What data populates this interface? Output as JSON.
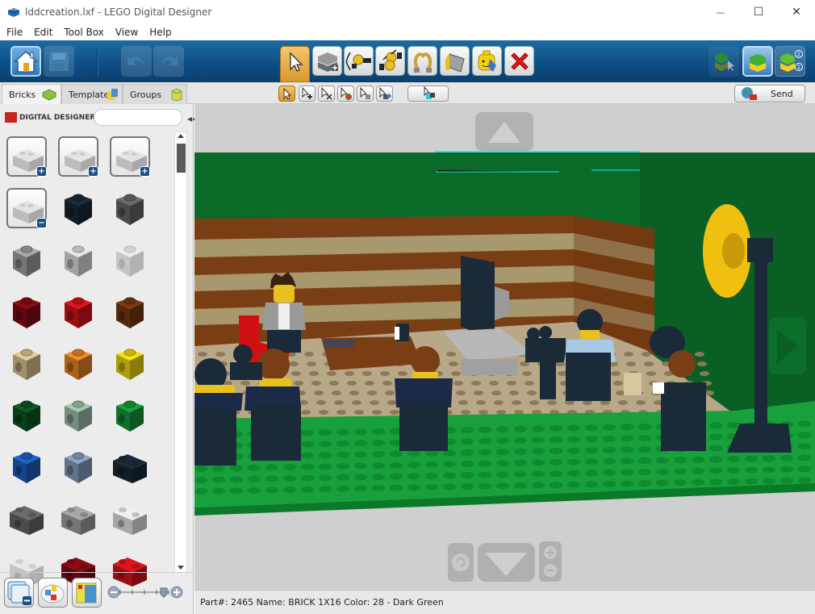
{
  "window": {
    "title": "lddcreation.lxf - LEGO Digital Designer",
    "controls": {
      "minimize": "—",
      "maximize": "☐",
      "close": "✕"
    }
  },
  "menu": {
    "items": [
      {
        "label": "File"
      },
      {
        "label": "Edit"
      },
      {
        "label": "Tool Box"
      },
      {
        "label": "View"
      },
      {
        "label": "Help"
      }
    ]
  },
  "toolbar": {
    "left": [
      {
        "name": "home",
        "icon": "home-icon",
        "enabled": true
      },
      {
        "name": "save",
        "icon": "save-icon",
        "enabled": false
      },
      {
        "name": "undo",
        "icon": "undo-icon",
        "enabled": false
      },
      {
        "name": "redo",
        "icon": "redo-icon",
        "enabled": false
      }
    ],
    "tools": [
      {
        "name": "select",
        "icon": "cursor-icon",
        "active": true
      },
      {
        "name": "clone",
        "icon": "clone-brick-icon"
      },
      {
        "name": "hinge",
        "icon": "hinge-icon"
      },
      {
        "name": "hinge-align",
        "icon": "hinge-align-icon"
      },
      {
        "name": "flex",
        "icon": "flex-icon"
      },
      {
        "name": "paint",
        "icon": "paint-bucket-icon"
      },
      {
        "name": "decorate",
        "icon": "minifig-decorate-icon"
      },
      {
        "name": "delete",
        "icon": "delete-x-icon"
      }
    ],
    "modes": [
      {
        "name": "build-mode",
        "icon": "build-mode-icon"
      },
      {
        "name": "view-mode",
        "icon": "view-mode-icon"
      },
      {
        "name": "building-guide-mode",
        "icon": "building-guide-icon"
      }
    ]
  },
  "palette_tabs": [
    {
      "label": "Bricks",
      "active": true
    },
    {
      "label": "Templates",
      "active": false
    },
    {
      "label": "Groups",
      "active": false
    }
  ],
  "select_subtools": [
    {
      "name": "single-select",
      "active": true
    },
    {
      "name": "add-to-selection"
    },
    {
      "name": "remove-from-selection"
    },
    {
      "name": "select-same-color"
    },
    {
      "name": "select-same-shape"
    },
    {
      "name": "select-same-color-shape"
    }
  ],
  "wide_subtool": {
    "name": "select-connected"
  },
  "send": {
    "label": "Send"
  },
  "sidebar": {
    "brand": "DIGITAL DESIGNER",
    "search_placeholder": "",
    "bricks": [
      {
        "kind": "brick-2x4-group",
        "color": "#d6d6d6",
        "badge": "+"
      },
      {
        "kind": "round-brick-group",
        "color": "#d6d6d6",
        "badge": "+"
      },
      {
        "kind": "technic-brick-group",
        "color": "#d6d6d6",
        "badge": "+"
      },
      {
        "kind": "technic-beam-group",
        "color": "#d6d6d6",
        "badge": "−"
      },
      {
        "kind": "technic-1x1",
        "color": "#1a2a38"
      },
      {
        "kind": "technic-1x1",
        "color": "#6b6b6b"
      },
      {
        "kind": "technic-1x1",
        "color": "#a8a8a8"
      },
      {
        "kind": "technic-1x1",
        "color": "#e8e8e8"
      },
      {
        "kind": "technic-1x1",
        "color": "#f0f0f0",
        "transparent": true
      },
      {
        "kind": "technic-1x1",
        "color": "#8c0a14"
      },
      {
        "kind": "technic-1x1",
        "color": "#e0141a"
      },
      {
        "kind": "technic-1x1",
        "color": "#7a3a12"
      },
      {
        "kind": "technic-1x1",
        "color": "#e4cd9a"
      },
      {
        "kind": "technic-1x1",
        "color": "#f08c28"
      },
      {
        "kind": "technic-1x1",
        "color": "#f8e010"
      },
      {
        "kind": "technic-1x1",
        "color": "#0c5a24"
      },
      {
        "kind": "technic-1x1",
        "color": "#a8c8b0"
      },
      {
        "kind": "technic-1x1",
        "color": "#14a03c"
      },
      {
        "kind": "technic-1x1",
        "color": "#1e64c8"
      },
      {
        "kind": "technic-1x1",
        "color": "#8ca4c8"
      },
      {
        "kind": "technic-1x2",
        "color": "#1a2a38"
      },
      {
        "kind": "technic-1x2",
        "color": "#6b6b6b"
      },
      {
        "kind": "technic-1x2",
        "color": "#a8a8a8"
      },
      {
        "kind": "technic-1x2",
        "color": "#f0f0f0"
      },
      {
        "kind": "technic-1x2",
        "color": "#e8e8e8",
        "transparent": true
      },
      {
        "kind": "technic-1x2",
        "color": "#8c0a14"
      },
      {
        "kind": "technic-1x2",
        "color": "#e0141a"
      }
    ],
    "bottom_buttons": [
      {
        "name": "collapse-groups",
        "icon": "collapse-groups-icon"
      },
      {
        "name": "color-palette",
        "icon": "color-palette-icon"
      },
      {
        "name": "brick-filter",
        "icon": "brick-filter-icon"
      }
    ],
    "zoom_slider": {
      "value": 0.9,
      "ticks": 5
    }
  },
  "viewport": {
    "scene": "LEGO studio set with minifigures, camera, TV monitor, desk and spotlight on green baseplate",
    "colors": {
      "background": "#cfcfcf",
      "wall_green": "#0a6a28",
      "baseplate_green": "#18a03c",
      "floor_tan": "#b8a888",
      "stripe_brown": "#7a3e14",
      "stripe_tan": "#a8986e",
      "highlight": "#20e8f0"
    },
    "nav": {
      "up": "nav-up-arrow-icon",
      "down": "nav-down-arrow-icon",
      "right": "nav-right-arrow-icon",
      "rotate": "rotate-view-icon",
      "zoom_in": "+",
      "zoom_out": "−"
    }
  },
  "status": {
    "text": "Part#: 2465 Name: BRICK 1X16 Color: 28 - Dark Green"
  }
}
